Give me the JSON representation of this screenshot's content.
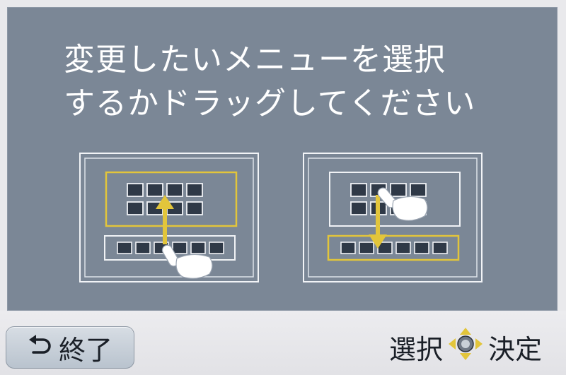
{
  "instruction": {
    "line1": "変更したいメニューを選択",
    "line2": "するかドラッグしてください"
  },
  "footer": {
    "end_label": "終了",
    "select_label": "選択",
    "confirm_label": "決定"
  },
  "icons": {
    "back": "return-arrow-icon",
    "dpad": "cross-key-icon"
  },
  "colors": {
    "screen_bg": "#7b8796",
    "highlight": "#e2c53b",
    "footer_bg": "#e6e6e9"
  }
}
